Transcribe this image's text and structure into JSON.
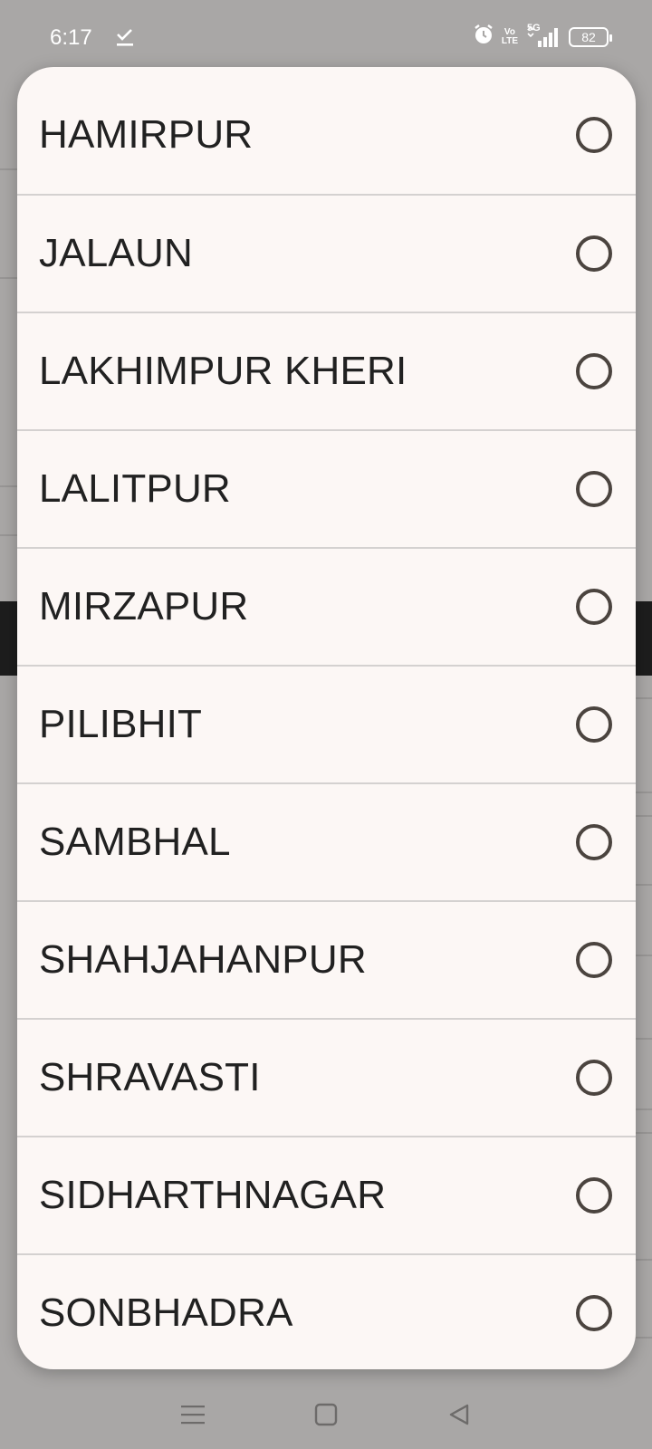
{
  "status_bar": {
    "time": "6:17",
    "volte_top": "Vo",
    "volte_bottom": "LTE",
    "network": "5G",
    "battery": "82"
  },
  "dialog": {
    "options": [
      {
        "label": "HAMIRPUR",
        "selected": false
      },
      {
        "label": "JALAUN",
        "selected": false
      },
      {
        "label": "LAKHIMPUR KHERI",
        "selected": false
      },
      {
        "label": "LALITPUR",
        "selected": false
      },
      {
        "label": "MIRZAPUR",
        "selected": false
      },
      {
        "label": "PILIBHIT",
        "selected": false
      },
      {
        "label": "SAMBHAL",
        "selected": false
      },
      {
        "label": "SHAHJAHANPUR",
        "selected": false
      },
      {
        "label": "SHRAVASTI",
        "selected": false
      },
      {
        "label": "SIDHARTHNAGAR",
        "selected": false
      },
      {
        "label": "SONBHADRA",
        "selected": false
      }
    ]
  },
  "nav": {
    "menu_icon": "menu-icon",
    "home_icon": "home-icon",
    "back_icon": "back-icon"
  }
}
